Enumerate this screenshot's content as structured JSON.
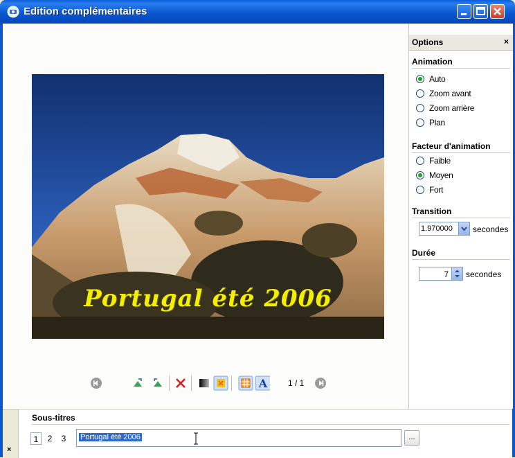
{
  "window": {
    "title": "Edition complémentaires"
  },
  "options": {
    "header": "Options",
    "close": "×",
    "animation": {
      "label": "Animation",
      "choices": [
        "Auto",
        "Zoom avant",
        "Zoom arrière",
        "Plan"
      ],
      "selected": "Auto"
    },
    "factor": {
      "label": "Facteur d'animation",
      "choices": [
        "Faible",
        "Moyen",
        "Fort"
      ],
      "selected": "Moyen"
    },
    "transition": {
      "label": "Transition",
      "value": "1.970000",
      "unit": "secondes"
    },
    "duration": {
      "label": "Durée",
      "value": "7",
      "unit": "secondes"
    }
  },
  "slide": {
    "caption": "Portugal été 2006",
    "counter": "1 / 1"
  },
  "subtitles": {
    "label": "Sous-titres",
    "tabs": [
      "1",
      "2",
      "3"
    ],
    "active_tab": "1",
    "text": "Portugal été 2006",
    "more_button": "...",
    "close": "×"
  },
  "colors": {
    "titlebar": "#0a58d0",
    "caption": "#f2f000",
    "selection": "#316ac5"
  }
}
